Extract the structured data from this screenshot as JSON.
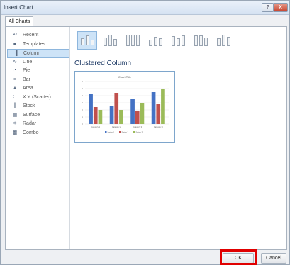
{
  "window": {
    "title": "Insert Chart",
    "help": "?",
    "close": "X"
  },
  "tabs": [
    {
      "label": "All Charts"
    }
  ],
  "sidebar": {
    "items": [
      {
        "label": "Recent",
        "icon": "recent-icon",
        "glyph": "↶"
      },
      {
        "label": "Templates",
        "icon": "templates-icon",
        "glyph": "■"
      },
      {
        "label": "Column",
        "icon": "column-chart-icon",
        "glyph": "▐",
        "selected": true
      },
      {
        "label": "Line",
        "icon": "line-chart-icon",
        "glyph": "∿"
      },
      {
        "label": "Pie",
        "icon": "pie-chart-icon",
        "glyph": "◔"
      },
      {
        "label": "Bar",
        "icon": "bar-chart-icon",
        "glyph": "≡"
      },
      {
        "label": "Area",
        "icon": "area-chart-icon",
        "glyph": "▲"
      },
      {
        "label": "X Y (Scatter)",
        "icon": "scatter-chart-icon",
        "glyph": "∷"
      },
      {
        "label": "Stock",
        "icon": "stock-chart-icon",
        "glyph": "┃"
      },
      {
        "label": "Surface",
        "icon": "surface-chart-icon",
        "glyph": "▦"
      },
      {
        "label": "Radar",
        "icon": "radar-chart-icon",
        "glyph": "✶"
      },
      {
        "label": "Combo",
        "icon": "combo-chart-icon",
        "glyph": "▓"
      }
    ]
  },
  "subtypes": [
    {
      "name": "clustered-column",
      "selected": true
    },
    {
      "name": "stacked-column"
    },
    {
      "name": "100-stacked-column"
    },
    {
      "name": "3d-clustered-column"
    },
    {
      "name": "3d-stacked-column"
    },
    {
      "name": "3d-100-stacked-column"
    },
    {
      "name": "3d-column"
    }
  ],
  "main": {
    "section_title": "Clustered Column"
  },
  "preview": {
    "title": "Chart Title",
    "categories": [
      "Category 1",
      "Category 2",
      "Category 3",
      "Category 4"
    ],
    "series": [
      {
        "name": "Series 1",
        "color": "#4472c4",
        "values": [
          4.3,
          2.5,
          3.5,
          4.5
        ]
      },
      {
        "name": "Series 2",
        "color": "#c0504d",
        "values": [
          2.4,
          4.4,
          1.8,
          2.8
        ]
      },
      {
        "name": "Series 3",
        "color": "#9bbb59",
        "values": [
          2.0,
          2.0,
          3.0,
          5.0
        ]
      }
    ],
    "ymax": 6
  },
  "buttons": {
    "ok": "OK",
    "cancel": "Cancel"
  },
  "colors": {
    "highlight": "#e00000",
    "selection": "#cde3f7"
  }
}
